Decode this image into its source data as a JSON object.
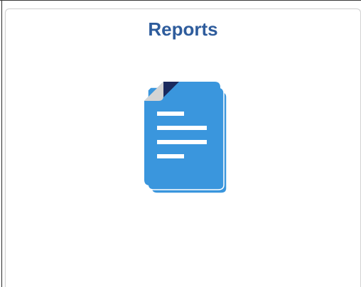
{
  "tile": {
    "title": "Reports",
    "icon": "reports-document-stack-icon"
  },
  "colors": {
    "title": "#2e5c9c",
    "document": "#3a96dd",
    "document_lines": "#ffffff",
    "corner_fold": "#d4d4d4",
    "corner_accent": "#1a2a5e"
  }
}
